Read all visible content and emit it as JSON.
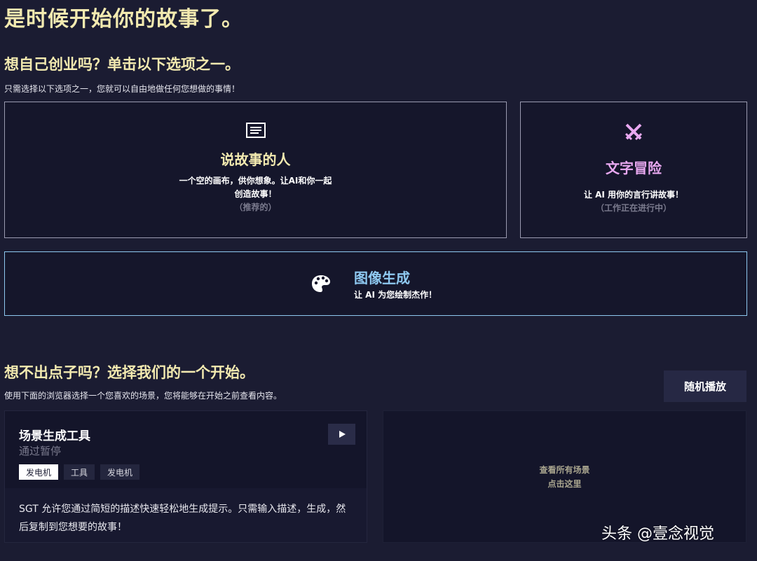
{
  "page": {
    "title": "是时候开始你的故事了。"
  },
  "start": {
    "heading": "想自己创业吗？单击以下选项之一。",
    "subtitle": "只需选择以下选项之一，您就可以自由地做任何您想做的事情！"
  },
  "modes": {
    "storyteller": {
      "icon": "document-lines-icon",
      "title": "说故事的人",
      "desc_line1": "一个空的画布，供你想象。让AI和你一起",
      "desc_line2": "创造故事！",
      "note": "（推荐的）",
      "title_color": "#f3eab0"
    },
    "adventure": {
      "icon": "crossed-swords-icon",
      "title": "文字冒险",
      "desc": "让 AI 用你的言行讲故事！",
      "note": "（工作正在进行中）",
      "title_color": "#e8a8f0"
    },
    "image": {
      "icon": "palette-icon",
      "title": "图像生成",
      "desc": "让 AI 为您绘制杰作！",
      "title_color": "#8ec8f0"
    }
  },
  "browse": {
    "heading": "想不出点子吗？选择我们的一个开始。",
    "subtitle": "使用下面的浏览器选择一个您喜欢的场景，您将能够在开始之前查看内容。",
    "random_button": "随机播放"
  },
  "scene": {
    "title": "场景生成工具",
    "author": "通过暂停",
    "play_icon": "play-icon",
    "tags": [
      "发电机",
      "工具",
      "发电机"
    ],
    "description": "SGT 允许您通过简短的描述快速轻松地生成提示。只需输入描述，生成，然后复制到您想要的故事！"
  },
  "all_scenes": {
    "line1": "查看所有场景",
    "line2": "点击这里"
  },
  "watermark": {
    "text": "头条 @壹念视觉"
  }
}
